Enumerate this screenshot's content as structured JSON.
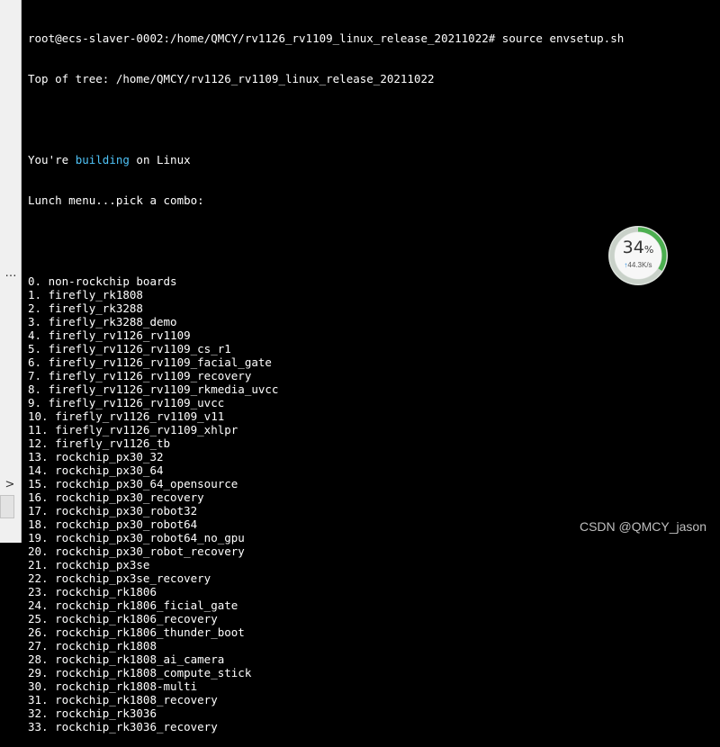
{
  "left_panel": {
    "dots": "…",
    "expand": ">"
  },
  "terminal": {
    "prompt_line": "root@ecs-slaver-0002:/home/QMCY/rv1126_rv1109_linux_release_20211022# source envsetup.sh",
    "top_of_tree": "Top of tree: /home/QMCY/rv1126_rv1109_linux_release_20211022",
    "building_prefix": "You're ",
    "building_word": "building",
    "building_suffix": " on Linux",
    "lunch_menu": "Lunch menu...pick a combo:",
    "items": [
      "0. non-rockchip boards",
      "1. firefly_rk1808",
      "2. firefly_rk3288",
      "3. firefly_rk3288_demo",
      "4. firefly_rv1126_rv1109",
      "5. firefly_rv1126_rv1109_cs_r1",
      "6. firefly_rv1126_rv1109_facial_gate",
      "7. firefly_rv1126_rv1109_recovery",
      "8. firefly_rv1126_rv1109_rkmedia_uvcc",
      "9. firefly_rv1126_rv1109_uvcc",
      "10. firefly_rv1126_rv1109_v11",
      "11. firefly_rv1126_rv1109_xhlpr",
      "12. firefly_rv1126_tb",
      "13. rockchip_px30_32",
      "14. rockchip_px30_64",
      "15. rockchip_px30_64_opensource",
      "16. rockchip_px30_recovery",
      "17. rockchip_px30_robot32",
      "18. rockchip_px30_robot64",
      "19. rockchip_px30_robot64_no_gpu",
      "20. rockchip_px30_robot_recovery",
      "21. rockchip_px3se",
      "22. rockchip_px3se_recovery",
      "23. rockchip_rk1806",
      "24. rockchip_rk1806_ficial_gate",
      "25. rockchip_rk1806_recovery",
      "26. rockchip_rk1806_thunder_boot",
      "27. rockchip_rk1808",
      "28. rockchip_rk1808_ai_camera",
      "29. rockchip_rk1808_compute_stick",
      "30. rockchip_rk1808-multi",
      "31. rockchip_rk1808_recovery",
      "32. rockchip_rk3036",
      "33. rockchip_rk3036_recovery"
    ]
  },
  "widget": {
    "percent": "34",
    "percent_sign": "%",
    "progress": 0.34,
    "arrow": "↑",
    "speed": "44.3K/s",
    "ring_color": "#4caf50"
  },
  "watermark": "CSDN @QMCY_jason"
}
